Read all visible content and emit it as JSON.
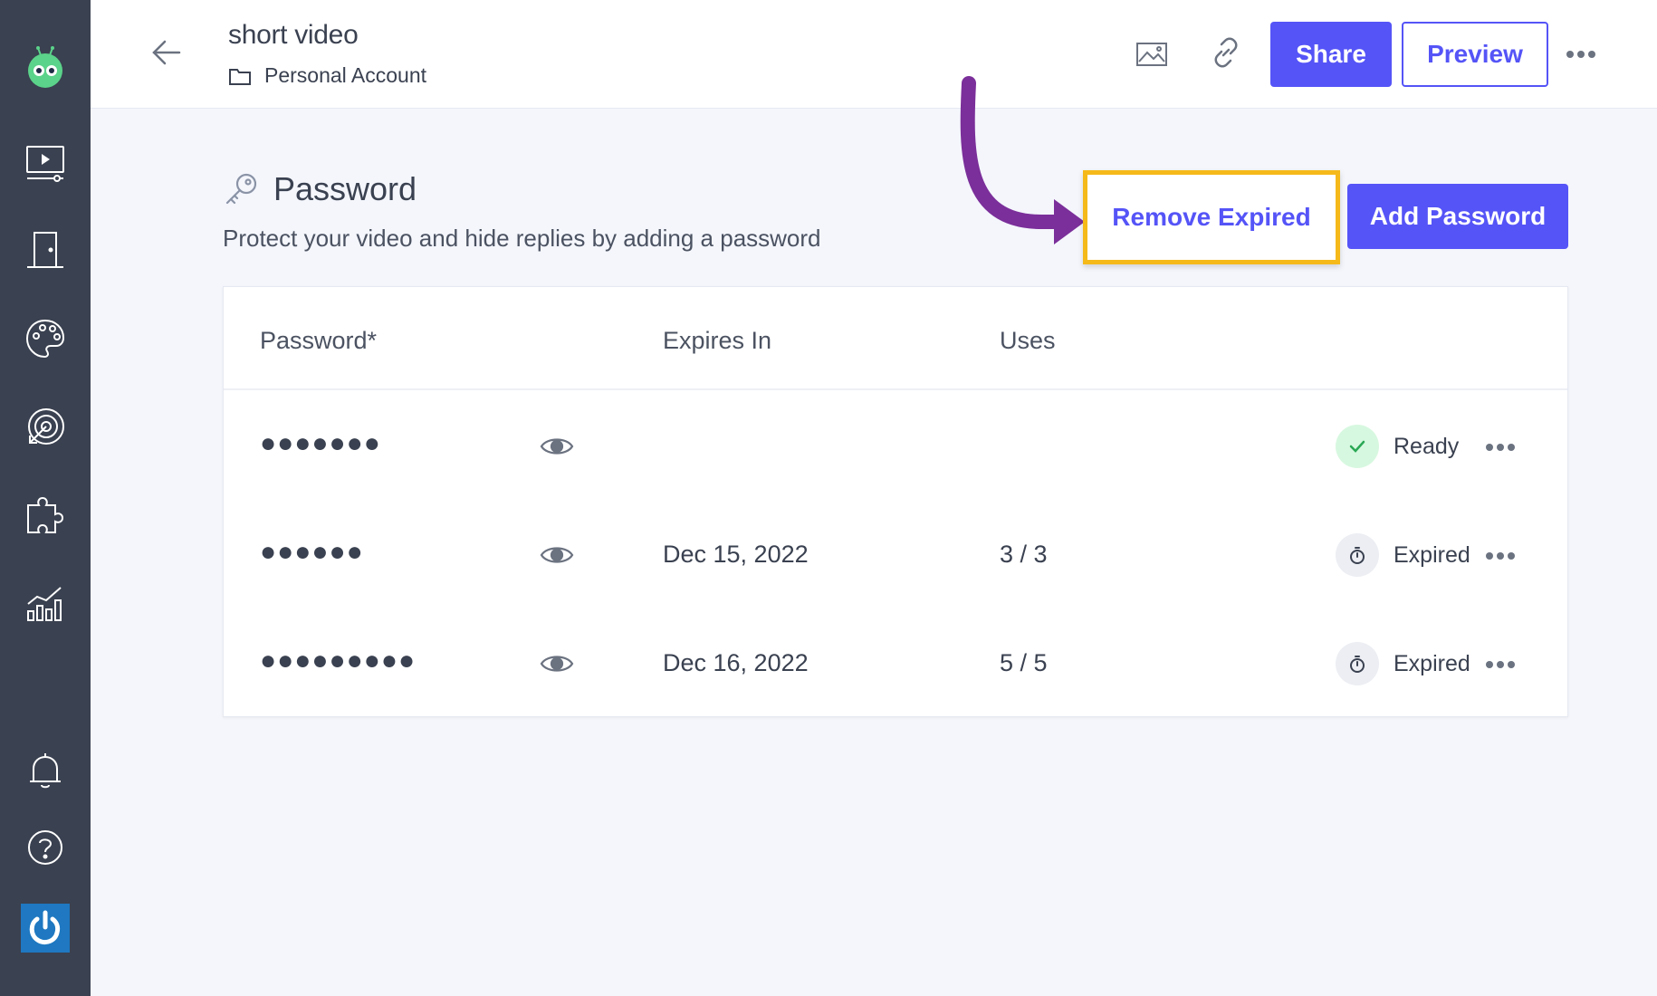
{
  "header": {
    "title": "short video",
    "breadcrumb": "Personal Account",
    "share_label": "Share",
    "preview_label": "Preview"
  },
  "section": {
    "title": "Password",
    "subtitle": "Protect your video and hide replies by adding a password",
    "remove_expired_label": "Remove Expired",
    "add_password_label": "Add Password"
  },
  "table": {
    "columns": [
      "Password*",
      "Expires In",
      "Uses"
    ],
    "rows": [
      {
        "password": "●●●●●●●",
        "expires": "",
        "uses": "",
        "status": "Ready"
      },
      {
        "password": "●●●●●●",
        "expires": "Dec 15, 2022",
        "uses": "3 / 3",
        "status": "Expired"
      },
      {
        "password": "●●●●●●●●●",
        "expires": "Dec 16, 2022",
        "uses": "5 / 5",
        "status": "Expired"
      }
    ]
  },
  "sidebar": {
    "icons": [
      "app-logo-icon",
      "video-icon",
      "door-icon",
      "palette-icon",
      "target-icon",
      "puzzle-icon",
      "analytics-icon",
      "bell-icon",
      "help-icon",
      "power-icon"
    ]
  },
  "colors": {
    "sidebar": "#3a4150",
    "accent": "#5554f7",
    "highlight_border": "#f5b919",
    "annotation_arrow": "#7b2f9a",
    "ready_badge": "#d7f8e0",
    "ready_check": "#2aa855"
  }
}
